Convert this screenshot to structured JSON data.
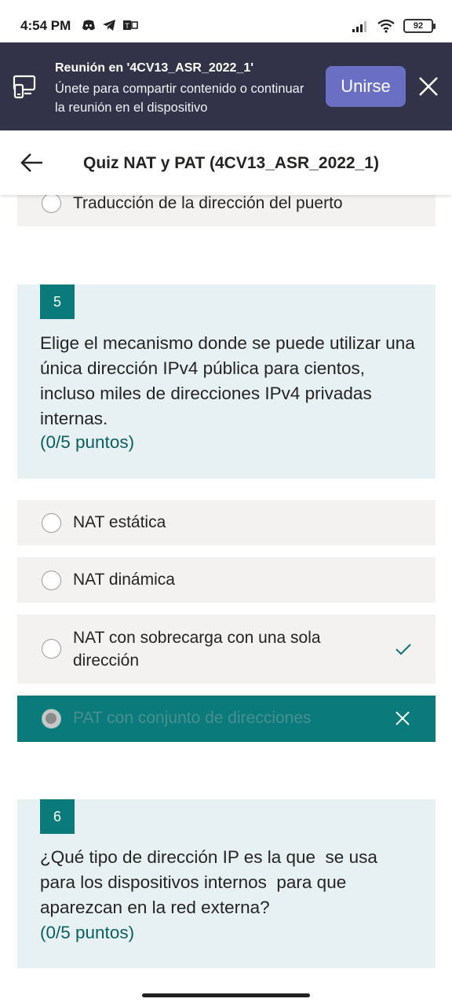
{
  "status_bar": {
    "time": "4:54 PM",
    "battery": "92",
    "icons": [
      "discord-icon",
      "telegram-icon",
      "teams-notification-icon",
      "signal-icon",
      "wifi-icon",
      "battery-icon"
    ]
  },
  "banner": {
    "title": "Reunión en '4CV13_ASR_2022_1'",
    "subtitle": "Únete para compartir contenido o continuar la reunión en el dispositivo",
    "join_label": "Unirse"
  },
  "header": {
    "title": "Quiz NAT y PAT (4CV13_ASR_2022_1)"
  },
  "previous_option": {
    "label": "Traducción de la dirección del puerto"
  },
  "questions": [
    {
      "number": "5",
      "text": "Elige el mecanismo donde se puede utilizar una única dirección IPv4 pública para cientos, incluso miles de direcciones IPv4 privadas internas.",
      "points": "(0/5 puntos)",
      "options": [
        {
          "label": "NAT estática",
          "state": "unselected"
        },
        {
          "label": "NAT dinámica",
          "state": "unselected"
        },
        {
          "label": "NAT con sobrecarga con una sola dirección",
          "state": "correct-answer"
        },
        {
          "label": "PAT con conjunto de direcciones",
          "state": "selected-wrong"
        }
      ]
    },
    {
      "number": "6",
      "text": "¿Qué tipo de dirección IP es la que  se usa para los dispositivos internos  para que aparezcan en la red externa?",
      "points": "(0/5 puntos)"
    }
  ],
  "colors": {
    "banner_bg": "#323348",
    "join_button": "#6a6fc4",
    "accent_teal": "#0a7a7a",
    "question_bg": "#e7f0f3",
    "option_bg": "#f3f2f1"
  }
}
